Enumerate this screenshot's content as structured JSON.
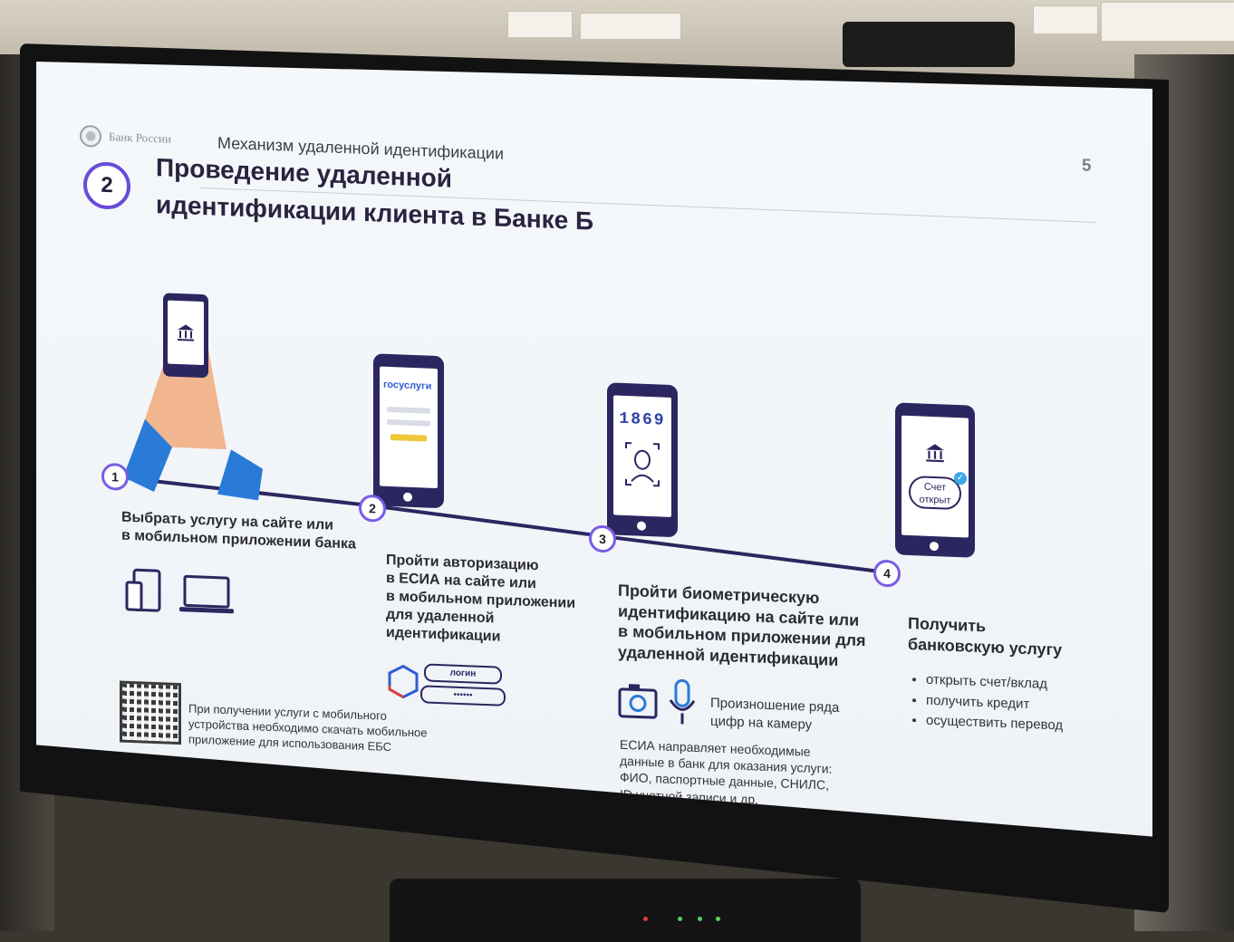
{
  "slide": {
    "org_name": "Банк России",
    "section_title": "Механизм удаленной идентификации",
    "page_number": "5",
    "step_badge": "2",
    "title_line1": "Проведение удаленной",
    "title_line2": "идентификации клиента в Банке Б"
  },
  "steps": [
    {
      "num": "1",
      "text_lines": [
        "Выбрать услугу на сайте или",
        "в мобильном приложении банка"
      ]
    },
    {
      "num": "2",
      "text_lines": [
        "Пройти авторизацию",
        "в ЕСИА на сайте или",
        "в мобильном приложении",
        "для удаленной",
        "идентификации"
      ],
      "screen_brand": "госуслуги",
      "login_label": "логин",
      "password_mask": "••••••"
    },
    {
      "num": "3",
      "text_lines": [
        "Пройти биометрическую",
        "идентификацию на сайте или",
        "в мобильном приложении для",
        "удаленной идентификации"
      ],
      "digits": "1869",
      "voice_note_lines": [
        "Произношение ряда",
        "цифр на камеру"
      ],
      "esia_note_lines": [
        "ЕСИА направляет необходимые",
        "данные в банк для оказания услуги:",
        "ФИО, паспортные данные, СНИЛС,",
        "ID учетной записи и др."
      ]
    },
    {
      "num": "4",
      "text_lines": [
        "Получить",
        "банковскую услугу"
      ],
      "badge_lines": [
        "Счет",
        "открыт"
      ],
      "bullets": [
        "открыть счет/вклад",
        "получить кредит",
        "осуществить перевод"
      ]
    }
  ],
  "qr_note_lines": [
    "При получении услуги с мобильного",
    "устройства необходимо скачать мобильное",
    "приложение для использования ЕБС"
  ],
  "colors": {
    "accent": "#6a4bd8",
    "phone": "#2c2660",
    "timeline": "#2c2660",
    "gosuslugi_blue": "#2f5bd3",
    "gosuslugi_red": "#e0413a"
  },
  "icons": [
    "bank-icon",
    "phone-tablet-icon",
    "laptop-icon",
    "face-scan-icon",
    "camera-icon",
    "microphone-icon",
    "check-icon",
    "qr-code"
  ]
}
